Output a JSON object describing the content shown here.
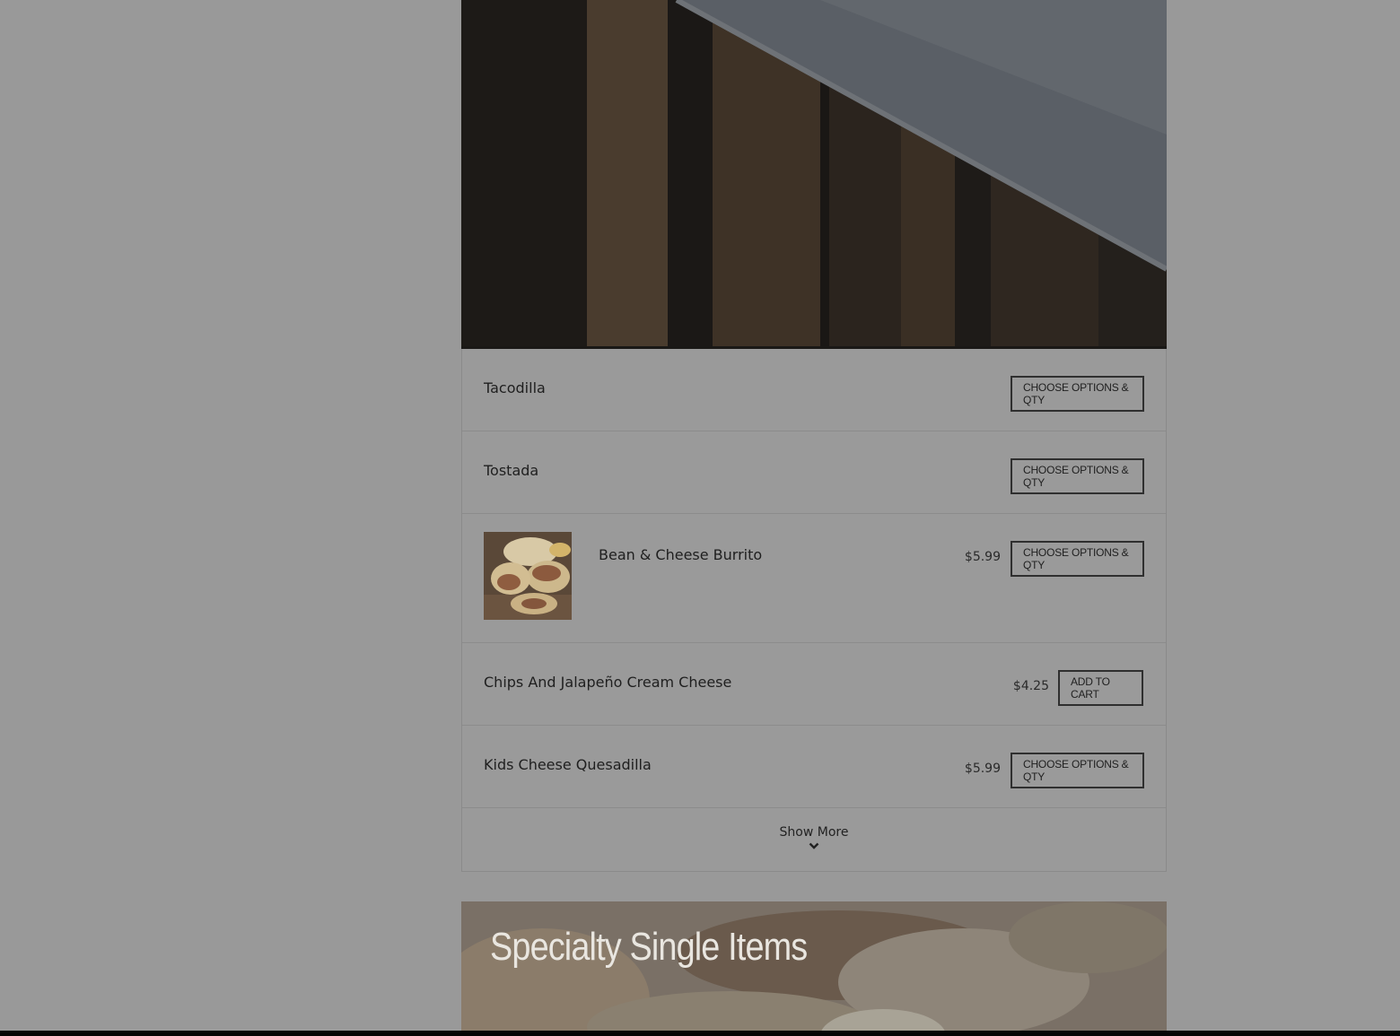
{
  "menu": {
    "items": [
      {
        "name": "Tacodilla",
        "price": "",
        "button": "Choose Options & Qty",
        "has_image": false
      },
      {
        "name": "Tostada",
        "price": "",
        "button": "Choose Options & Qty",
        "has_image": false
      },
      {
        "name": "Bean & Cheese Burrito",
        "price": "$5.99",
        "button": "Choose Options & Qty",
        "has_image": true,
        "image_icon": "burrito-photo"
      },
      {
        "name": "Chips And Jalapeño Cream Cheese",
        "price": "$4.25",
        "button": "Add To Cart",
        "has_image": false
      },
      {
        "name": "Kids Cheese Quesadilla",
        "price": "$5.99",
        "button": "Choose Options & Qty",
        "has_image": false
      }
    ],
    "show_more": "Show More"
  },
  "banner": {
    "title": "Specialty Single Items"
  },
  "colors": {
    "overlay_gray": "#999999",
    "button_border": "#2f2f2f",
    "text": "#1f1f1f"
  }
}
